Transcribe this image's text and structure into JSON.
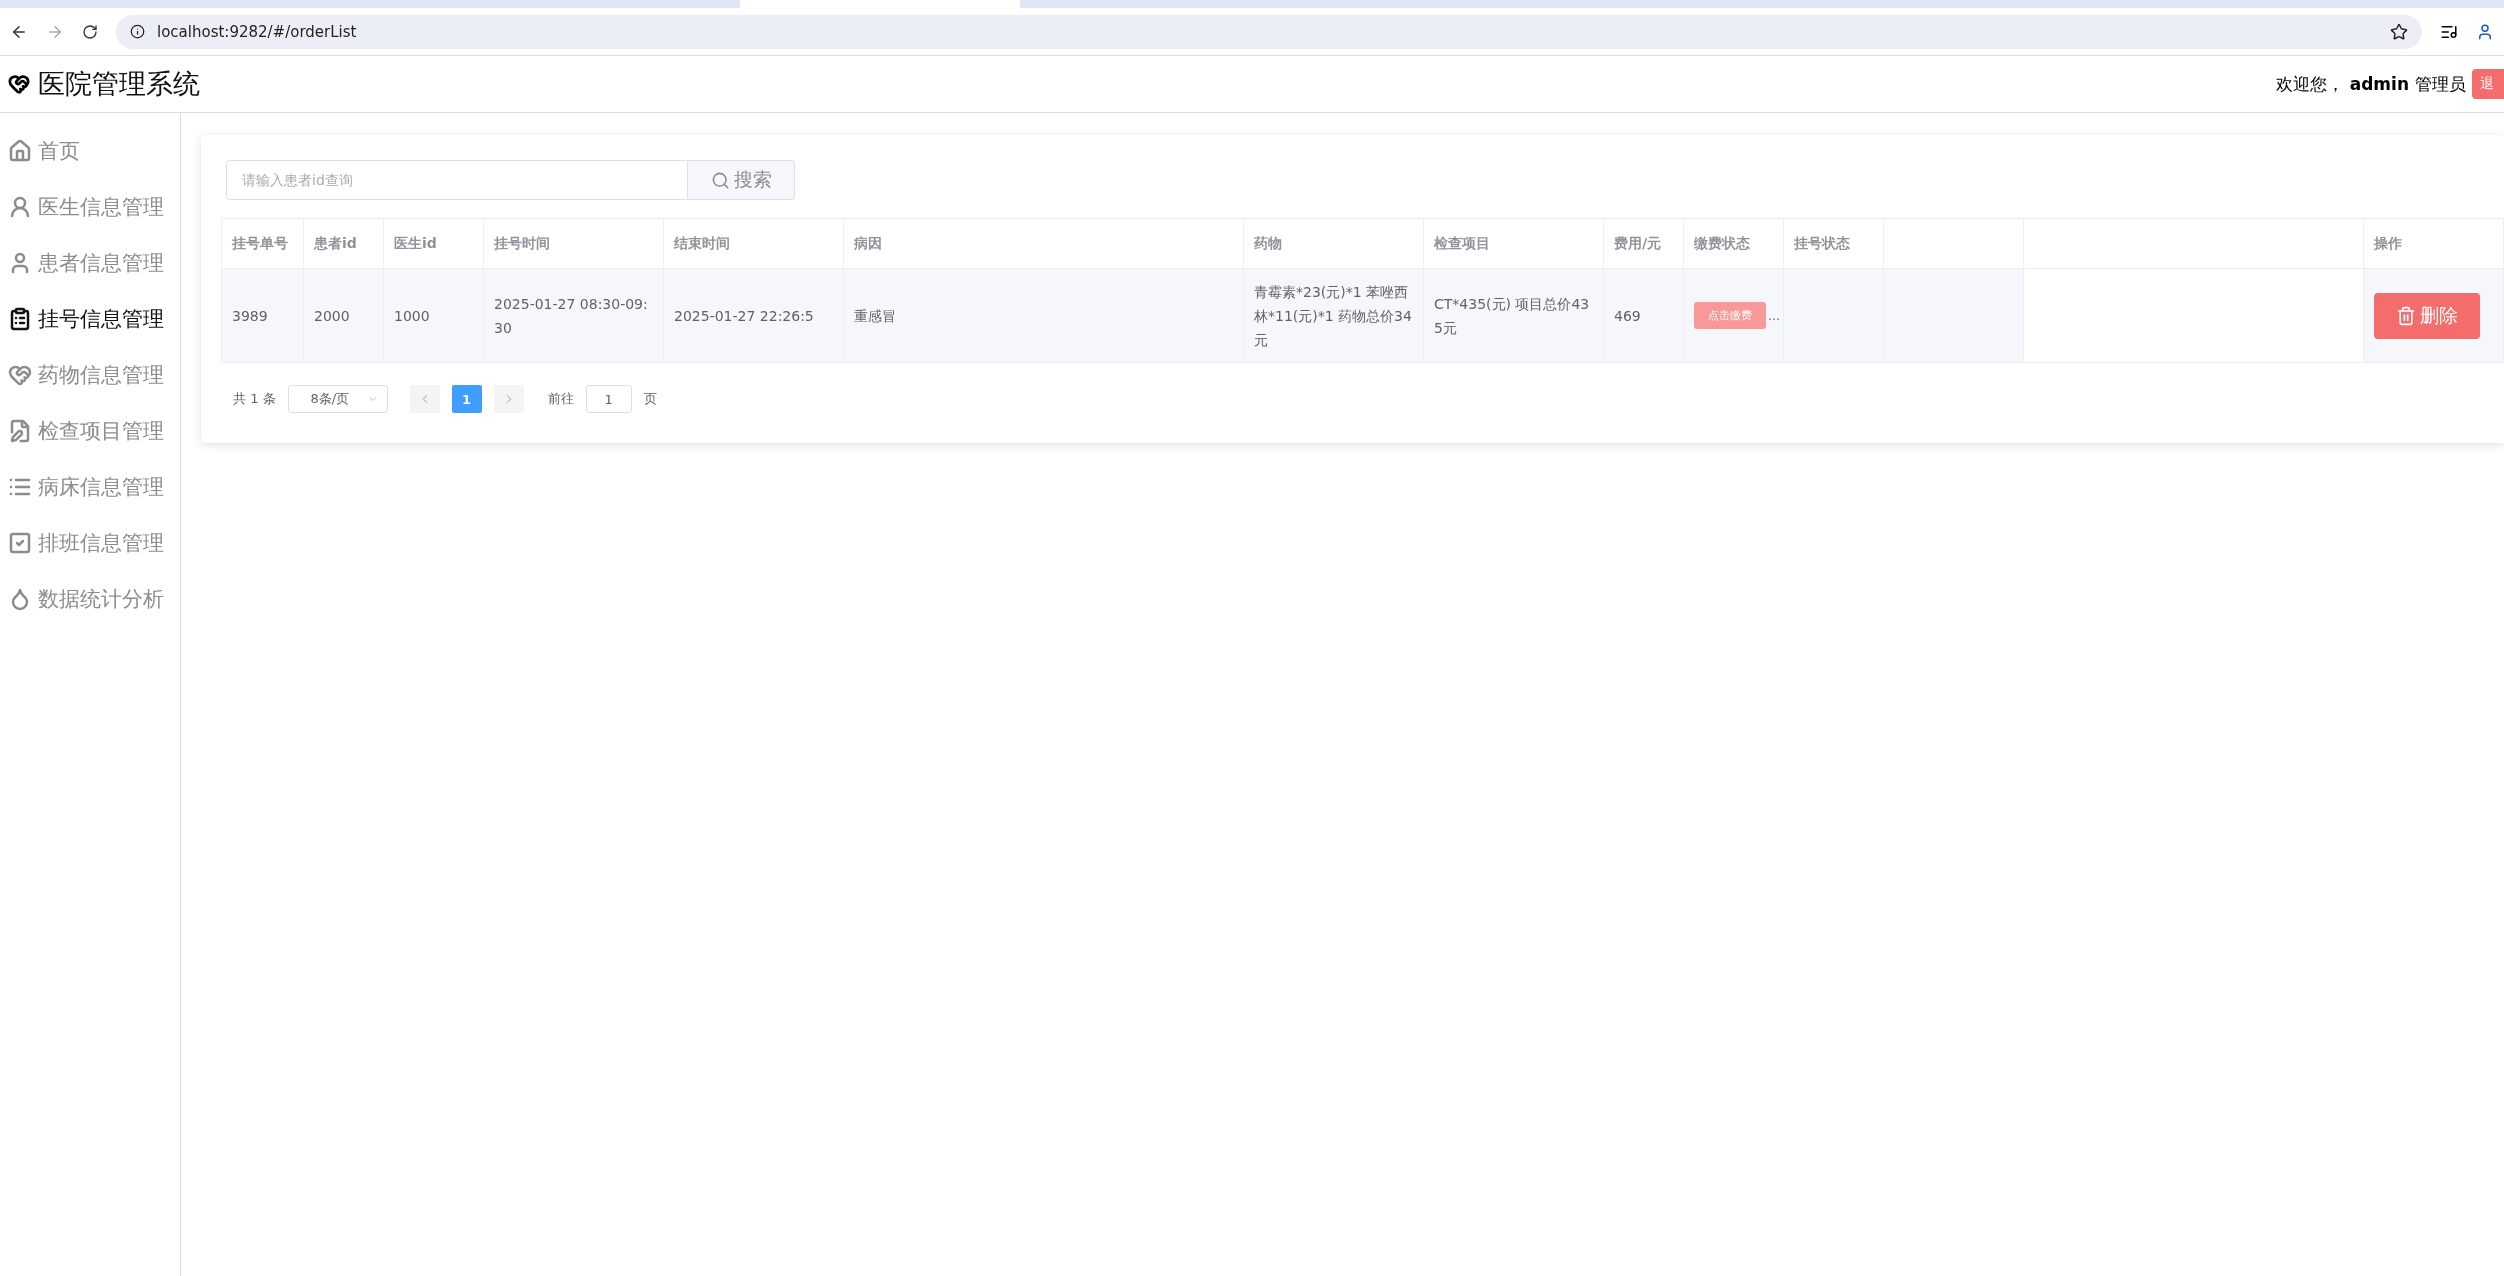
{
  "browser": {
    "url": "localhost:9282/#/orderList"
  },
  "header": {
    "title": "医院管理系统",
    "welcome": "欢迎您，",
    "user": "admin",
    "role": "管理员",
    "logout": "退"
  },
  "sidebar": {
    "items": [
      {
        "label": "首页",
        "selected": false
      },
      {
        "label": "医生信息管理",
        "selected": false
      },
      {
        "label": "患者信息管理",
        "selected": false
      },
      {
        "label": "挂号信息管理",
        "selected": true
      },
      {
        "label": "药物信息管理",
        "selected": false
      },
      {
        "label": "检查项目管理",
        "selected": false
      },
      {
        "label": "病床信息管理",
        "selected": false
      },
      {
        "label": "排班信息管理",
        "selected": false
      },
      {
        "label": "数据统计分析",
        "selected": false
      }
    ]
  },
  "search": {
    "placeholder": "请输入患者id查询",
    "button": "搜索"
  },
  "table": {
    "columns": [
      "挂号单号",
      "患者id",
      "医生id",
      "挂号时间",
      "结束时间",
      "病因",
      "药物",
      "检查项目",
      "费用/元",
      "缴费状态",
      "挂号状态"
    ],
    "action_column": "操作",
    "rows": [
      {
        "cells": [
          "3989",
          "2000",
          "1000",
          "2025-01-27 08:30-09:30",
          "2025-01-27 22:26:5",
          "重感冒",
          "青霉素*23(元)*1 苯唑西林*11(元)*1 药物总价34元",
          "CT*435(元) 项目总价435元",
          "469"
        ],
        "pay_button": "点击缴费",
        "pay_overflow": "…",
        "delete": "删除"
      }
    ]
  },
  "pagination": {
    "total": "共 1 条",
    "page_size": "8条/页",
    "pages": [
      {
        "label": "1",
        "selected": true
      }
    ],
    "goto": "前往",
    "goto_value": "1",
    "page_unit": "页"
  }
}
